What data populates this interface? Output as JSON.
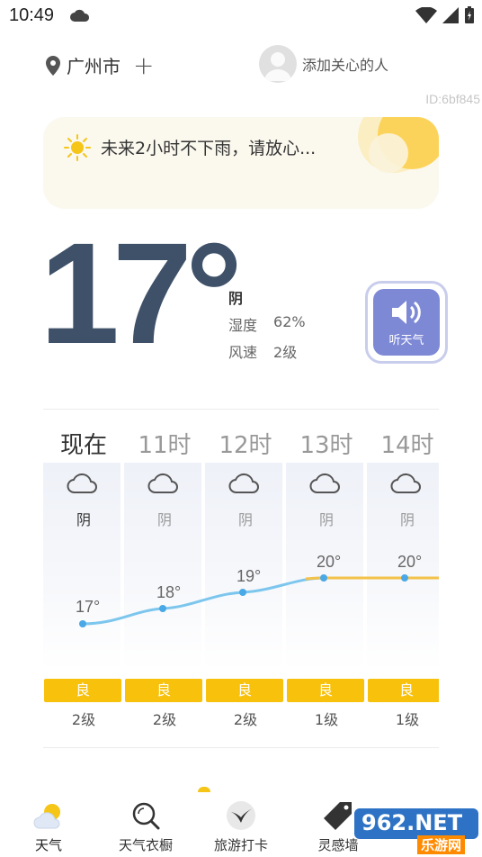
{
  "status": {
    "time": "10:49"
  },
  "header": {
    "city": "广州市",
    "add_symbol": "+",
    "care_label": "添加关心的人",
    "device_id": "ID:6bf845"
  },
  "rain_card": {
    "text": "未来2小时不下雨，请放心..."
  },
  "current": {
    "temperature": "17°",
    "condition": "阴",
    "humidity_label": "湿度",
    "humidity_value": "62%",
    "wind_label": "风速",
    "wind_value": "2级",
    "listen_label": "听天气"
  },
  "hourly": [
    {
      "time": "现在",
      "cond": "阴",
      "temp": "17°",
      "aqi": "良",
      "aqi_level": "2级"
    },
    {
      "time": "11时",
      "cond": "阴",
      "temp": "18°",
      "aqi": "良",
      "aqi_level": "2级"
    },
    {
      "time": "12时",
      "cond": "阴",
      "temp": "19°",
      "aqi": "良",
      "aqi_level": "2级"
    },
    {
      "time": "13时",
      "cond": "阴",
      "temp": "20°",
      "aqi": "良",
      "aqi_level": "1级"
    },
    {
      "time": "14时",
      "cond": "阴",
      "temp": "20°",
      "aqi": "良",
      "aqi_level": "1级"
    }
  ],
  "tabs": [
    {
      "label": "天气",
      "icon": "weather-icon"
    },
    {
      "label": "天气衣橱",
      "icon": "wardrobe-search-icon"
    },
    {
      "label": "旅游打卡",
      "icon": "travel-bird-icon"
    },
    {
      "label": "灵感墙",
      "icon": "tag-icon"
    }
  ],
  "watermark": {
    "main": "962.NET",
    "sub": "乐游网"
  },
  "colors": {
    "temp_text": "#3f5169",
    "accent_blue": "#7e89d6",
    "aqi_yellow": "#f7c10c",
    "curve_blue": "#7cc6ee"
  }
}
